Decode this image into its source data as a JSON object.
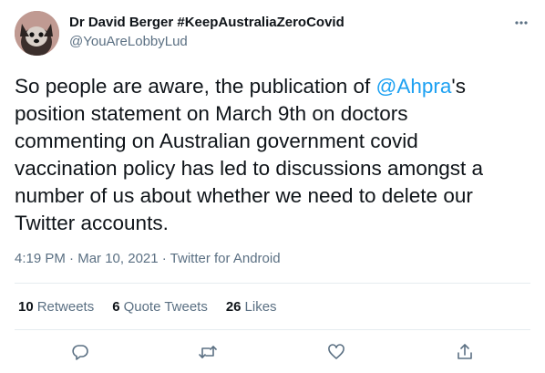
{
  "author": {
    "display_name": "Dr David Berger #KeepAustraliaZeroCovid",
    "handle": "@YouAreLobbyLud",
    "avatar": "dog-avatar"
  },
  "tweet": {
    "text_before": "So people are aware, the publication of ",
    "mention": "@Ahpra",
    "text_after": "'s position statement on March 9th on doctors commenting on Australian government covid vaccination policy has led to discussions amongst a number of us about whether we need to delete our Twitter accounts."
  },
  "meta": {
    "time": "4:19 PM",
    "sep1": " · ",
    "date": "Mar 10, 2021",
    "sep2": " · ",
    "source": "Twitter for Android"
  },
  "stats": {
    "retweets_count": "10",
    "retweets_label": "Retweets",
    "quotes_count": "6",
    "quotes_label": "Quote Tweets",
    "likes_count": "26",
    "likes_label": "Likes"
  },
  "icons": {
    "more": "more-icon",
    "reply": "reply-icon",
    "retweet": "retweet-icon",
    "like": "like-icon",
    "share": "share-icon"
  },
  "colors": {
    "link": "#1da1f2",
    "secondary": "#5b7083",
    "divider": "#e6ecf0"
  }
}
